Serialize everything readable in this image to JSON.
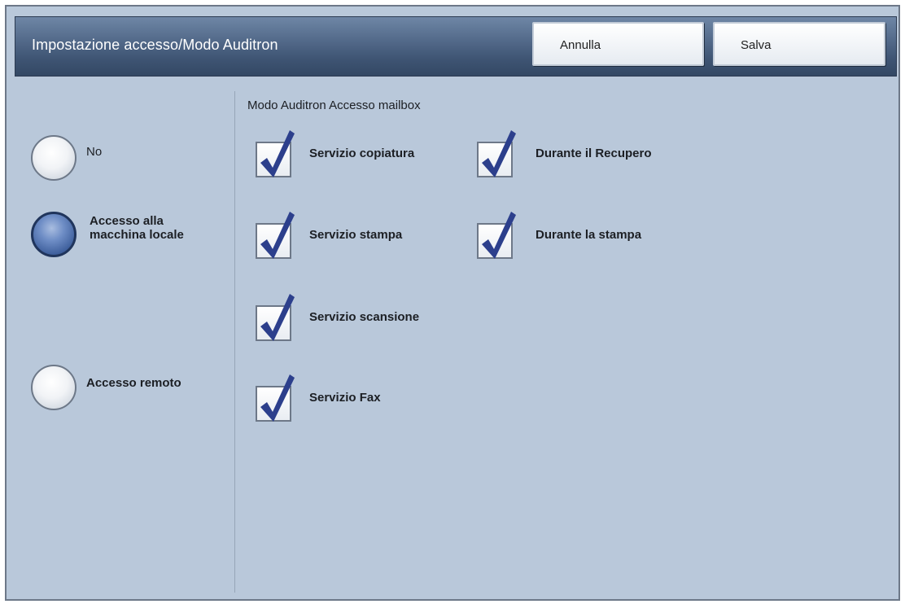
{
  "header": {
    "title": "Impostazione accesso/Modo Auditron",
    "cancel_label": "Annulla",
    "save_label": "Salva"
  },
  "access_options": [
    {
      "label": "No",
      "selected": false
    },
    {
      "label": "Accesso alla\nmacchina locale",
      "selected": true
    },
    {
      "label": "Accesso remoto",
      "selected": false
    }
  ],
  "section": {
    "title": "Modo Auditron Accesso mailbox"
  },
  "services": [
    {
      "label": "Servizio copiatura",
      "checked": true
    },
    {
      "label": "Servizio stampa",
      "checked": true
    },
    {
      "label": "Servizio scansione",
      "checked": true
    },
    {
      "label": "Servizio Fax",
      "checked": true
    }
  ],
  "mailbox_options": [
    {
      "label": "Durante il Recupero",
      "checked": true
    },
    {
      "label": "Durante la stampa",
      "checked": true
    }
  ],
  "colors": {
    "panel_bg": "#b9c8da",
    "header_bg": "#3f5574",
    "check_color": "#2c3f8c"
  }
}
